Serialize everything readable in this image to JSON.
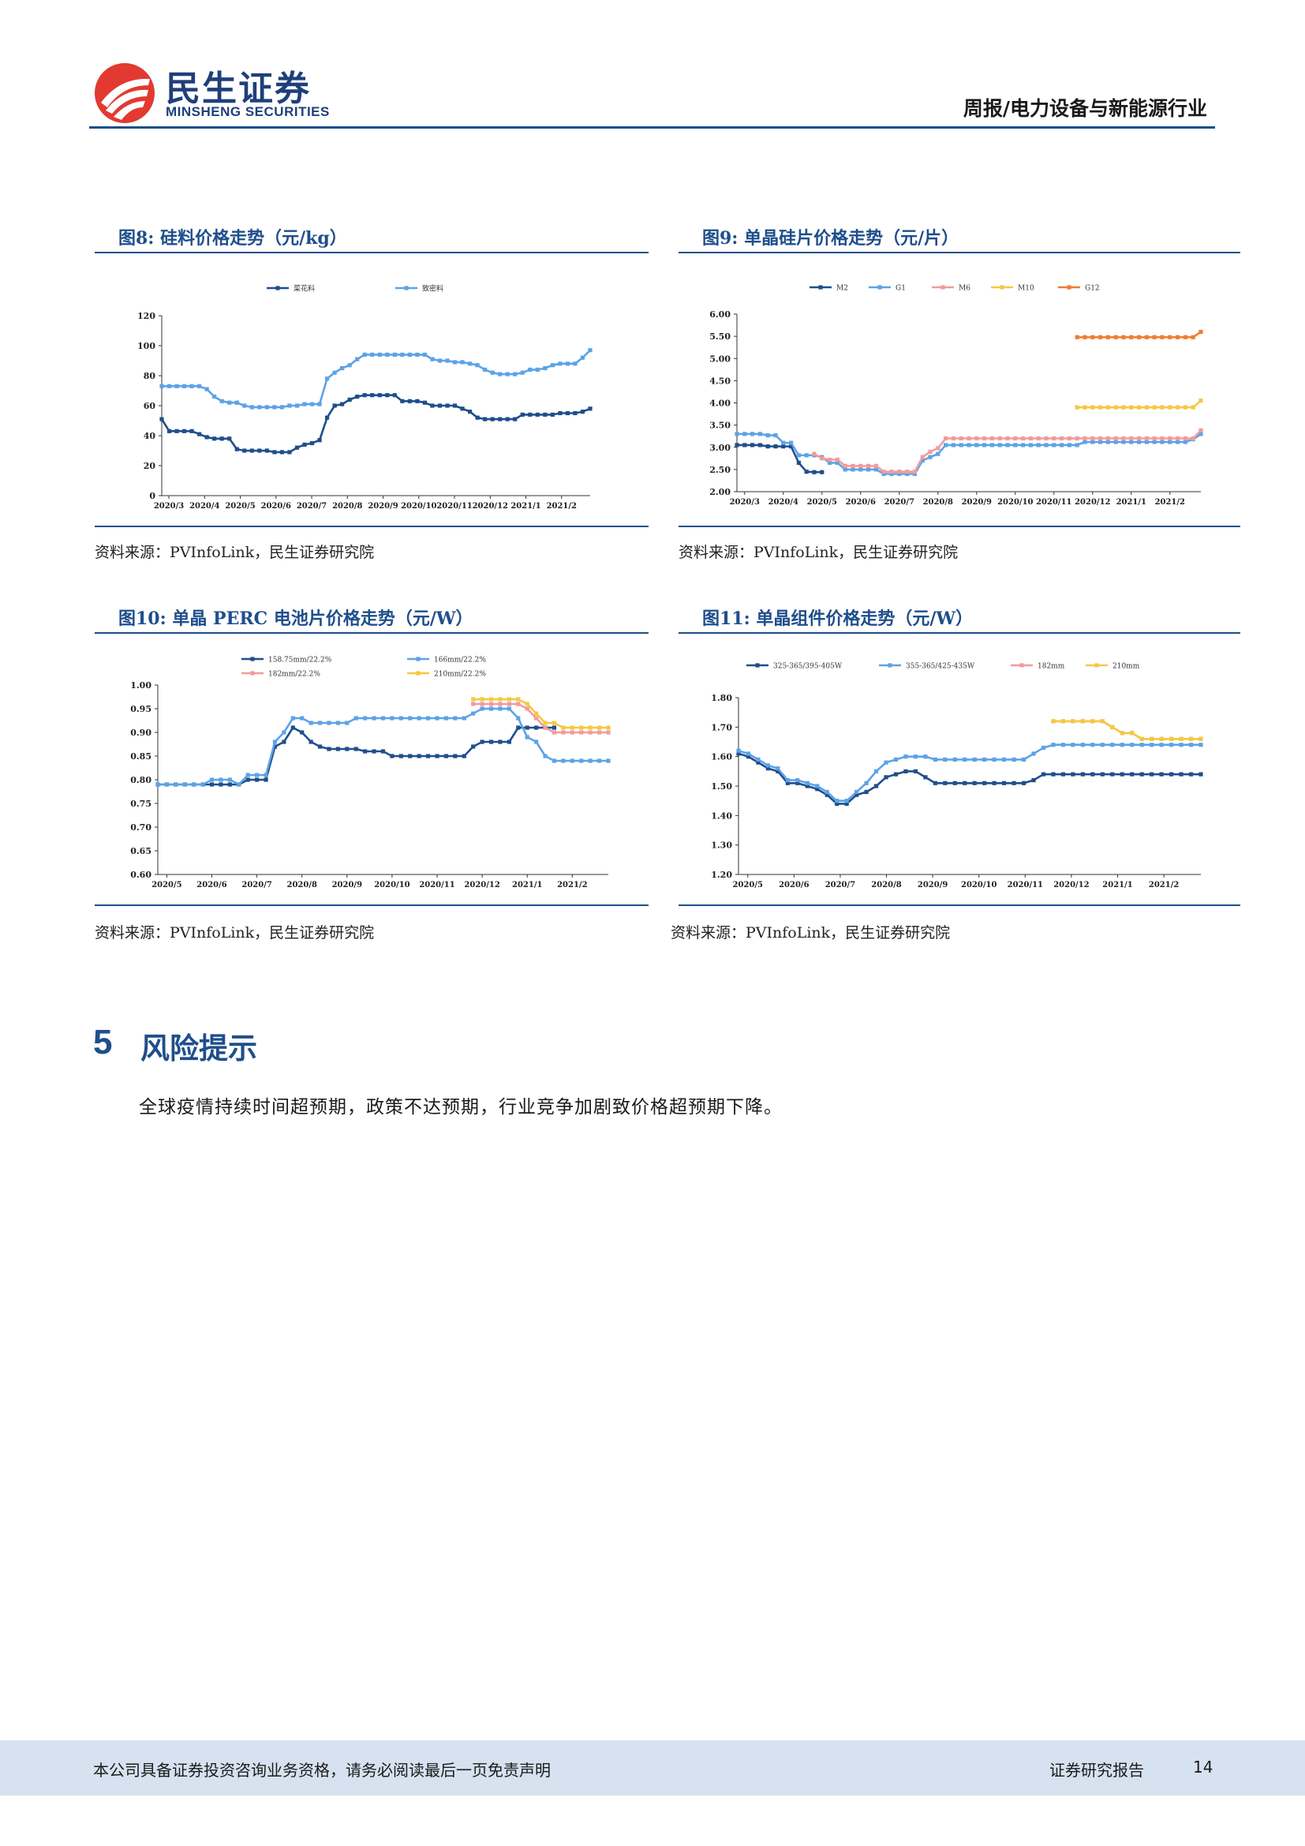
{
  "header": {
    "logo_cn": "民生证券",
    "logo_en": "MINSHENG SECURITIES",
    "report_type": "周报/电力设备与新能源行业"
  },
  "figures": {
    "fig8": {
      "title": "图8:  硅料价格走势（元/kg）",
      "source": "资料来源：PVInfoLink，民生证券研究院"
    },
    "fig9": {
      "title": "图9:  单晶硅片价格走势（元/片）",
      "source": "资料来源：PVInfoLink，民生证券研究院"
    },
    "fig10": {
      "title": "图10:        单晶 PERC 电池片价格走势（元/W）",
      "source": "资料来源：PVInfoLink，民生证券研究院"
    },
    "fig11": {
      "title": "图11:        单晶组件价格走势（元/W）",
      "source": "资料来源：PVInfoLink，民生证券研究院"
    }
  },
  "section": {
    "number": "5",
    "title": "风险提示",
    "body": "全球疫情持续时间超预期，政策不达预期，行业竞争加剧致价格超预期下降。"
  },
  "footer": {
    "disclaimer": "本公司具备证券投资咨询业务资格，请务必阅读最后一页免责声明",
    "label": "证券研究报告",
    "page": "14"
  },
  "chart_data": [
    {
      "id": "fig8",
      "type": "line",
      "x_tick_labels": [
        "2020/3",
        "2020/4",
        "2020/5",
        "2020/6",
        "2020/7",
        "2020/8",
        "2020/9",
        "2020/10",
        "2020/11",
        "2020/12",
        "2021/1",
        "2021/2"
      ],
      "ylim": [
        0,
        120
      ],
      "y_ticks": [
        0,
        20,
        40,
        60,
        80,
        100,
        120
      ],
      "y_tick_format": 0,
      "legend_position": "top",
      "series": [
        {
          "name": "菜花料",
          "color": "#1f4e8c",
          "values": [
            51,
            43,
            43,
            43,
            43,
            41,
            39,
            38,
            38,
            38,
            31,
            30,
            30,
            30,
            30,
            29,
            29,
            29,
            32,
            34,
            35,
            37,
            52,
            60,
            61,
            64,
            66,
            67,
            67,
            67,
            67,
            67,
            63,
            63,
            63,
            62,
            60,
            60,
            60,
            60,
            58,
            56,
            52,
            51,
            51,
            51,
            51,
            51,
            54,
            54,
            54,
            54,
            54,
            55,
            55,
            55,
            56,
            58
          ]
        },
        {
          "name": "致密料",
          "color": "#5ca3e6",
          "values": [
            73,
            73,
            73,
            73,
            73,
            73,
            71,
            66,
            63,
            62,
            62,
            60,
            59,
            59,
            59,
            59,
            59,
            60,
            60,
            61,
            61,
            61,
            78,
            82,
            85,
            87,
            91,
            94,
            94,
            94,
            94,
            94,
            94,
            94,
            94,
            94,
            91,
            90,
            90,
            89,
            89,
            88,
            87,
            84,
            82,
            81,
            81,
            81,
            82,
            84,
            84,
            85,
            87,
            88,
            88,
            88,
            92,
            97
          ]
        }
      ]
    },
    {
      "id": "fig9",
      "type": "line",
      "x_tick_labels": [
        "2020/3",
        "2020/4",
        "2020/5",
        "2020/6",
        "2020/7",
        "2020/8",
        "2020/9",
        "2020/10",
        "2020/11",
        "2020/12",
        "2021/1",
        "2021/2"
      ],
      "ylim": [
        2.0,
        6.0
      ],
      "y_ticks": [
        2.0,
        2.5,
        3.0,
        3.5,
        4.0,
        4.5,
        5.0,
        5.5,
        6.0
      ],
      "y_tick_format": 2,
      "legend_position": "top",
      "series": [
        {
          "name": "M2",
          "color": "#1f4e8c",
          "values": [
            3.05,
            3.05,
            3.05,
            3.05,
            3.02,
            3.02,
            3.02,
            3.02,
            2.65,
            2.45,
            2.44,
            2.44
          ]
        },
        {
          "name": "G1",
          "color": "#5ca3e6",
          "values": [
            3.3,
            3.3,
            3.3,
            3.3,
            3.27,
            3.27,
            3.1,
            3.1,
            2.82,
            2.82,
            2.82,
            2.78,
            2.65,
            2.65,
            2.5,
            2.5,
            2.5,
            2.5,
            2.5,
            2.4,
            2.4,
            2.4,
            2.4,
            2.4,
            2.7,
            2.78,
            2.85,
            3.05,
            3.05,
            3.05,
            3.05,
            3.05,
            3.05,
            3.05,
            3.05,
            3.05,
            3.05,
            3.05,
            3.05,
            3.05,
            3.05,
            3.05,
            3.05,
            3.05,
            3.05,
            3.12,
            3.12,
            3.12,
            3.12,
            3.12,
            3.12,
            3.12,
            3.12,
            3.12,
            3.12,
            3.12,
            3.12,
            3.12,
            3.12,
            3.18,
            3.3
          ]
        },
        {
          "name": "M6",
          "color": "#f29b9b",
          "start_index": 10,
          "values": [
            2.85,
            2.75,
            2.72,
            2.72,
            2.58,
            2.58,
            2.58,
            2.58,
            2.58,
            2.45,
            2.45,
            2.45,
            2.45,
            2.45,
            2.78,
            2.9,
            2.98,
            3.2,
            3.2,
            3.2,
            3.2,
            3.2,
            3.2,
            3.2,
            3.2,
            3.2,
            3.2,
            3.2,
            3.2,
            3.2,
            3.2,
            3.2,
            3.2,
            3.2,
            3.2,
            3.2,
            3.2,
            3.2,
            3.2,
            3.2,
            3.2,
            3.2,
            3.2,
            3.2,
            3.2,
            3.2,
            3.2,
            3.2,
            3.2,
            3.2,
            3.38
          ]
        },
        {
          "name": "M10",
          "color": "#f5c842",
          "start_index": 44,
          "values": [
            3.9,
            3.9,
            3.9,
            3.9,
            3.9,
            3.9,
            3.9,
            3.9,
            3.9,
            3.9,
            3.9,
            3.9,
            3.9,
            3.9,
            3.9,
            3.9,
            4.05
          ]
        },
        {
          "name": "G12",
          "color": "#ee7d31",
          "start_index": 44,
          "values": [
            5.48,
            5.48,
            5.48,
            5.48,
            5.48,
            5.48,
            5.48,
            5.48,
            5.48,
            5.48,
            5.48,
            5.48,
            5.48,
            5.48,
            5.48,
            5.48,
            5.6
          ]
        }
      ]
    },
    {
      "id": "fig10",
      "type": "line",
      "x_tick_labels": [
        "2020/5",
        "2020/6",
        "2020/7",
        "2020/8",
        "2020/9",
        "2020/10",
        "2020/11",
        "2020/12",
        "2021/1",
        "2021/2"
      ],
      "ylim": [
        0.6,
        1.0
      ],
      "y_ticks": [
        0.6,
        0.65,
        0.7,
        0.75,
        0.8,
        0.85,
        0.9,
        0.95,
        1.0
      ],
      "y_tick_format": 2,
      "legend_position": "top",
      "series": [
        {
          "name": "158.75mm/22.2%",
          "color": "#1f4e8c",
          "values": [
            0.79,
            0.79,
            0.79,
            0.79,
            0.79,
            0.79,
            0.79,
            0.79,
            0.79,
            0.79,
            0.8,
            0.8,
            0.8,
            0.87,
            0.88,
            0.91,
            0.9,
            0.88,
            0.87,
            0.865,
            0.865,
            0.865,
            0.865,
            0.86,
            0.86,
            0.86,
            0.85,
            0.85,
            0.85,
            0.85,
            0.85,
            0.85,
            0.85,
            0.85,
            0.85,
            0.87,
            0.88,
            0.88,
            0.88,
            0.88,
            0.91,
            0.91,
            0.91,
            0.91,
            0.91
          ]
        },
        {
          "name": "166mm/22.2%",
          "color": "#5ca3e6",
          "values": [
            0.79,
            0.79,
            0.79,
            0.79,
            0.79,
            0.79,
            0.8,
            0.8,
            0.8,
            0.79,
            0.81,
            0.81,
            0.81,
            0.88,
            0.9,
            0.93,
            0.93,
            0.92,
            0.92,
            0.92,
            0.92,
            0.92,
            0.93,
            0.93,
            0.93,
            0.93,
            0.93,
            0.93,
            0.93,
            0.93,
            0.93,
            0.93,
            0.93,
            0.93,
            0.93,
            0.94,
            0.95,
            0.95,
            0.95,
            0.95,
            0.93,
            0.89,
            0.88,
            0.85,
            0.84,
            0.84,
            0.84,
            0.84,
            0.84,
            0.84,
            0.84
          ]
        },
        {
          "name": "182mm/22.2%",
          "color": "#f29b9b",
          "start_index": 35,
          "values": [
            0.96,
            0.96,
            0.96,
            0.96,
            0.96,
            0.96,
            0.95,
            0.93,
            0.91,
            0.9,
            0.9,
            0.9,
            0.9,
            0.9,
            0.9,
            0.9
          ]
        },
        {
          "name": "210mm/22.2%",
          "color": "#f5c842",
          "start_index": 35,
          "values": [
            0.97,
            0.97,
            0.97,
            0.97,
            0.97,
            0.97,
            0.96,
            0.94,
            0.92,
            0.92,
            0.91,
            0.91,
            0.91,
            0.91,
            0.91,
            0.91
          ]
        }
      ]
    },
    {
      "id": "fig11",
      "type": "line",
      "x_tick_labels": [
        "2020/5",
        "2020/6",
        "2020/7",
        "2020/8",
        "2020/9",
        "2020/10",
        "2020/11",
        "2020/12",
        "2021/1",
        "2021/2"
      ],
      "ylim": [
        1.2,
        1.8
      ],
      "y_ticks": [
        1.2,
        1.3,
        1.4,
        1.5,
        1.6,
        1.7,
        1.8
      ],
      "y_tick_format": 2,
      "legend_position": "top",
      "series": [
        {
          "name": "325-365/395-405W",
          "color": "#1f4e8c",
          "values": [
            1.61,
            1.6,
            1.58,
            1.56,
            1.55,
            1.51,
            1.51,
            1.5,
            1.49,
            1.47,
            1.44,
            1.44,
            1.47,
            1.48,
            1.5,
            1.53,
            1.54,
            1.55,
            1.55,
            1.53,
            1.51,
            1.51,
            1.51,
            1.51,
            1.51,
            1.51,
            1.51,
            1.51,
            1.51,
            1.51,
            1.52,
            1.54,
            1.54,
            1.54,
            1.54,
            1.54,
            1.54,
            1.54,
            1.54,
            1.54,
            1.54,
            1.54,
            1.54,
            1.54,
            1.54,
            1.54,
            1.54,
            1.54
          ]
        },
        {
          "name": "355-365/425-435W",
          "color": "#5ca3e6",
          "values": [
            1.62,
            1.61,
            1.59,
            1.57,
            1.56,
            1.52,
            1.52,
            1.51,
            1.5,
            1.48,
            1.45,
            1.45,
            1.48,
            1.51,
            1.55,
            1.58,
            1.59,
            1.6,
            1.6,
            1.6,
            1.59,
            1.59,
            1.59,
            1.59,
            1.59,
            1.59,
            1.59,
            1.59,
            1.59,
            1.59,
            1.61,
            1.63,
            1.64,
            1.64,
            1.64,
            1.64,
            1.64,
            1.64,
            1.64,
            1.64,
            1.64,
            1.64,
            1.64,
            1.64,
            1.64,
            1.64,
            1.64,
            1.64
          ]
        },
        {
          "name": "182mm",
          "color": "#f29b9b",
          "start_index": 32,
          "values": [
            1.72,
            1.72,
            1.72,
            1.72,
            1.72,
            1.72,
            1.7,
            1.68,
            1.68,
            1.66,
            1.66,
            1.66,
            1.66,
            1.66,
            1.66,
            1.66
          ]
        },
        {
          "name": "210mm",
          "color": "#f5c842",
          "start_index": 32,
          "values": [
            1.72,
            1.72,
            1.72,
            1.72,
            1.72,
            1.72,
            1.7,
            1.68,
            1.68,
            1.66,
            1.66,
            1.66,
            1.66,
            1.66,
            1.66,
            1.66
          ]
        }
      ]
    }
  ]
}
